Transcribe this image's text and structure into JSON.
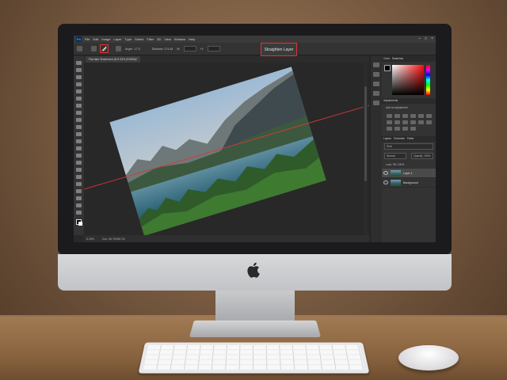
{
  "menu": {
    "logo": "Ps",
    "items": [
      "File",
      "Edit",
      "Image",
      "Layer",
      "Type",
      "Select",
      "Filter",
      "3D",
      "View",
      "Window",
      "Help"
    ],
    "window_controls": [
      "–",
      "□",
      "×"
    ]
  },
  "options_bar": {
    "angle_label": "Angle: -17.0",
    "measure_label": "Distance: 274.45",
    "w_label": "W:",
    "h_label": "H:",
    "straighten_label": "Straighten Layer",
    "accent_color": "#e0332f"
  },
  "document": {
    "tab_label": "Flat lake Shadowed @ 8.33% (RGB/8)*"
  },
  "status": {
    "zoom": "8.33%",
    "doc_info": "Doc: 68.7M/68.7M"
  },
  "panels": {
    "color_tabs": [
      "Color",
      "Swatches"
    ],
    "adjust_tabs": [
      "Adjustments"
    ],
    "adjust_sub": "Add an adjustment",
    "layers_tabs": [
      "Layers",
      "Channels",
      "Paths"
    ],
    "kind_filter": "Kind",
    "blend_mode": "Normal",
    "opacity": "Opacity: 100%",
    "lock_fill": "Lock: Fill: 100%",
    "layers": [
      {
        "name": "Layer 1",
        "selected": true
      },
      {
        "name": "Background",
        "selected": false
      }
    ]
  },
  "icons": [
    "ps-logo-icon",
    "home-icon",
    "ruler-tool-icon",
    "brush-icon",
    "eye-icon",
    "apple-logo-icon"
  ]
}
